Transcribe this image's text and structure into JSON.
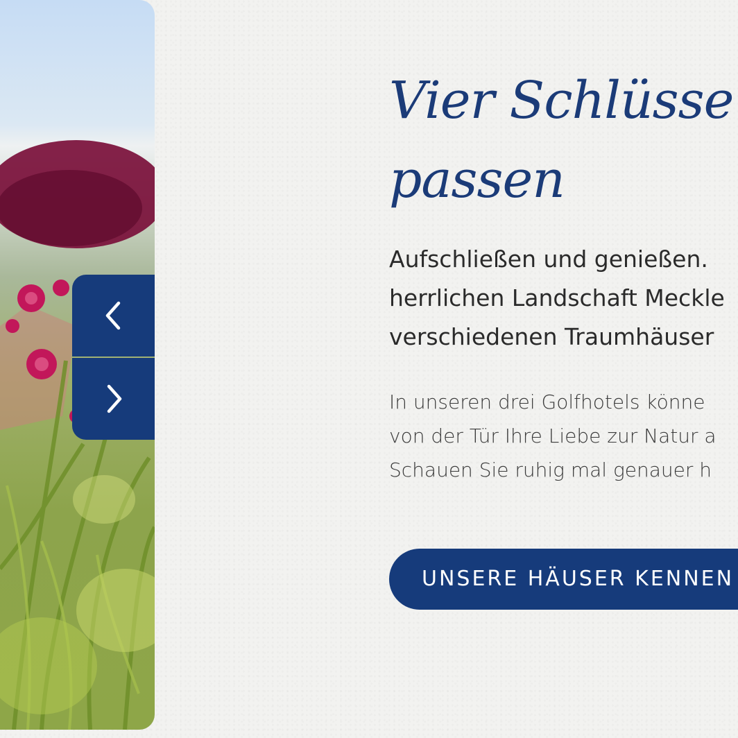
{
  "slider": {
    "image_subject": "meadow-flowers-photo",
    "prev_icon": "chevron-left-icon",
    "next_icon": "chevron-right-icon"
  },
  "headline": {
    "line1": "Vier Schlüsse",
    "line2": "passen"
  },
  "lead": {
    "line1": "Aufschließen und genießen.",
    "line2": "herrlichen Landschaft Meckle",
    "line3": "verschiedenen Traumhäuser"
  },
  "body": {
    "line1": "In unseren drei Golfhotels könne",
    "line2": "von der Tür Ihre Liebe zur Natur a",
    "line3": "Schauen Sie ruhig mal genauer h"
  },
  "cta": {
    "label": "UNSERE HÄUSER KENNEN"
  },
  "colors": {
    "brand_blue": "#163b7b",
    "headline_blue": "#1b3b78",
    "background": "#f2f2f0",
    "text_dark": "#2a2a2a"
  }
}
